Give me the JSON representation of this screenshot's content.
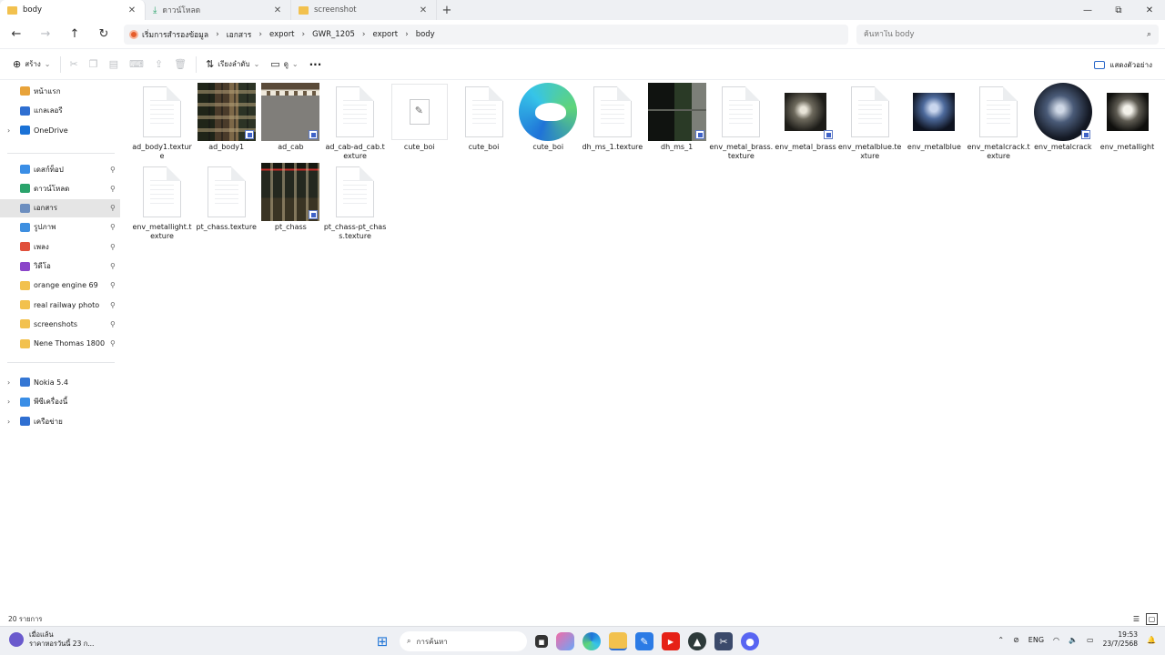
{
  "tabs": [
    {
      "label": "body",
      "active": true
    },
    {
      "label": "ดาวน์โหลด",
      "active": false
    },
    {
      "label": "screenshot",
      "active": false
    }
  ],
  "window": {
    "minimize": "—",
    "maximize": "⧉",
    "close": "✕"
  },
  "breadcrumb": [
    "เริ่มการสำรองข้อมูล",
    "เอกสาร",
    "export",
    "GWR_1205",
    "export",
    "body"
  ],
  "search": {
    "placeholder": "ค้นหาใน body"
  },
  "commands": {
    "new": "สร้าง",
    "sort": "เรียงลำดับ",
    "view": "ดู",
    "more": "···",
    "preview": "แสดงตัวอย่าง"
  },
  "sidebar": {
    "top": [
      {
        "label": "หน้าแรก",
        "icon": "home-icon",
        "color": "#e8a33a"
      },
      {
        "label": "แกลเลอรี",
        "icon": "gallery-icon",
        "color": "#2f6fd1"
      },
      {
        "label": "OneDrive",
        "icon": "cloud-icon",
        "color": "#1b72d6",
        "chevron": true
      }
    ],
    "pinned": [
      {
        "label": "เดสก์ท็อป",
        "icon": "desktop-icon",
        "color": "#3a8ee6"
      },
      {
        "label": "ดาวน์โหลด",
        "icon": "download-icon",
        "color": "#2aa36b"
      },
      {
        "label": "เอกสาร",
        "icon": "documents-icon",
        "color": "#6c8ebf",
        "active": true
      },
      {
        "label": "รูปภาพ",
        "icon": "pictures-icon",
        "color": "#3e8fe0"
      },
      {
        "label": "เพลง",
        "icon": "music-icon",
        "color": "#e0503c"
      },
      {
        "label": "วิดีโอ",
        "icon": "video-icon",
        "color": "#8b45c9"
      },
      {
        "label": "orange engine 69",
        "icon": "folder-icon",
        "color": "#f2c14e"
      },
      {
        "label": "real railway photo",
        "icon": "folder-icon",
        "color": "#f2c14e"
      },
      {
        "label": "screenshots",
        "icon": "folder-icon",
        "color": "#f2c14e"
      },
      {
        "label": "Nene Thomas 1800",
        "icon": "folder-icon",
        "color": "#f2c14e"
      }
    ],
    "devices": [
      {
        "label": "Nokia 5.4",
        "icon": "phone-icon",
        "color": "#3577d4"
      },
      {
        "label": "พีซีเครื่องนี้",
        "icon": "pc-icon",
        "color": "#3a8ee6"
      },
      {
        "label": "เครือข่าย",
        "icon": "network-icon",
        "color": "#2f6fd1"
      }
    ]
  },
  "files": [
    {
      "name": "ad_body1.texture",
      "kind": "doc"
    },
    {
      "name": "ad_body1",
      "kind": "tex"
    },
    {
      "name": "ad_cab",
      "kind": "cab"
    },
    {
      "name": "ad_cab-ad_cab.texture",
      "kind": "doc"
    },
    {
      "name": "cute_boi",
      "kind": "cute"
    },
    {
      "name": "cute_boi",
      "kind": "doc"
    },
    {
      "name": "cute_boi",
      "kind": "edge"
    },
    {
      "name": "dh_ms_1.texture",
      "kind": "doc"
    },
    {
      "name": "dh_ms_1",
      "kind": "dh"
    },
    {
      "name": "env_metal_brass.texture",
      "kind": "doc"
    },
    {
      "name": "env_metal_brass",
      "kind": "sphere"
    },
    {
      "name": "env_metalblue.texture",
      "kind": "doc"
    },
    {
      "name": "env_metalblue",
      "kind": "blue"
    },
    {
      "name": "env_metalcrack.texture",
      "kind": "doc"
    },
    {
      "name": "env_metalcrack",
      "kind": "crack"
    },
    {
      "name": "env_metallight",
      "kind": "light"
    },
    {
      "name": "env_metallight.texture",
      "kind": "doc"
    },
    {
      "name": "pt_chass.texture",
      "kind": "doc"
    },
    {
      "name": "pt_chass",
      "kind": "chass"
    },
    {
      "name": "pt_chass-pt_chass.texture",
      "kind": "doc"
    }
  ],
  "status": {
    "count": "20 รายการ"
  },
  "taskbar": {
    "weather_title": "เมื่อแล้น",
    "weather_sub": "ราคาหอรวันนี้ 23 ก...",
    "search_placeholder": "การค้นหา",
    "lang": "ENG",
    "time": "19:53",
    "date": "23/7/2568"
  }
}
